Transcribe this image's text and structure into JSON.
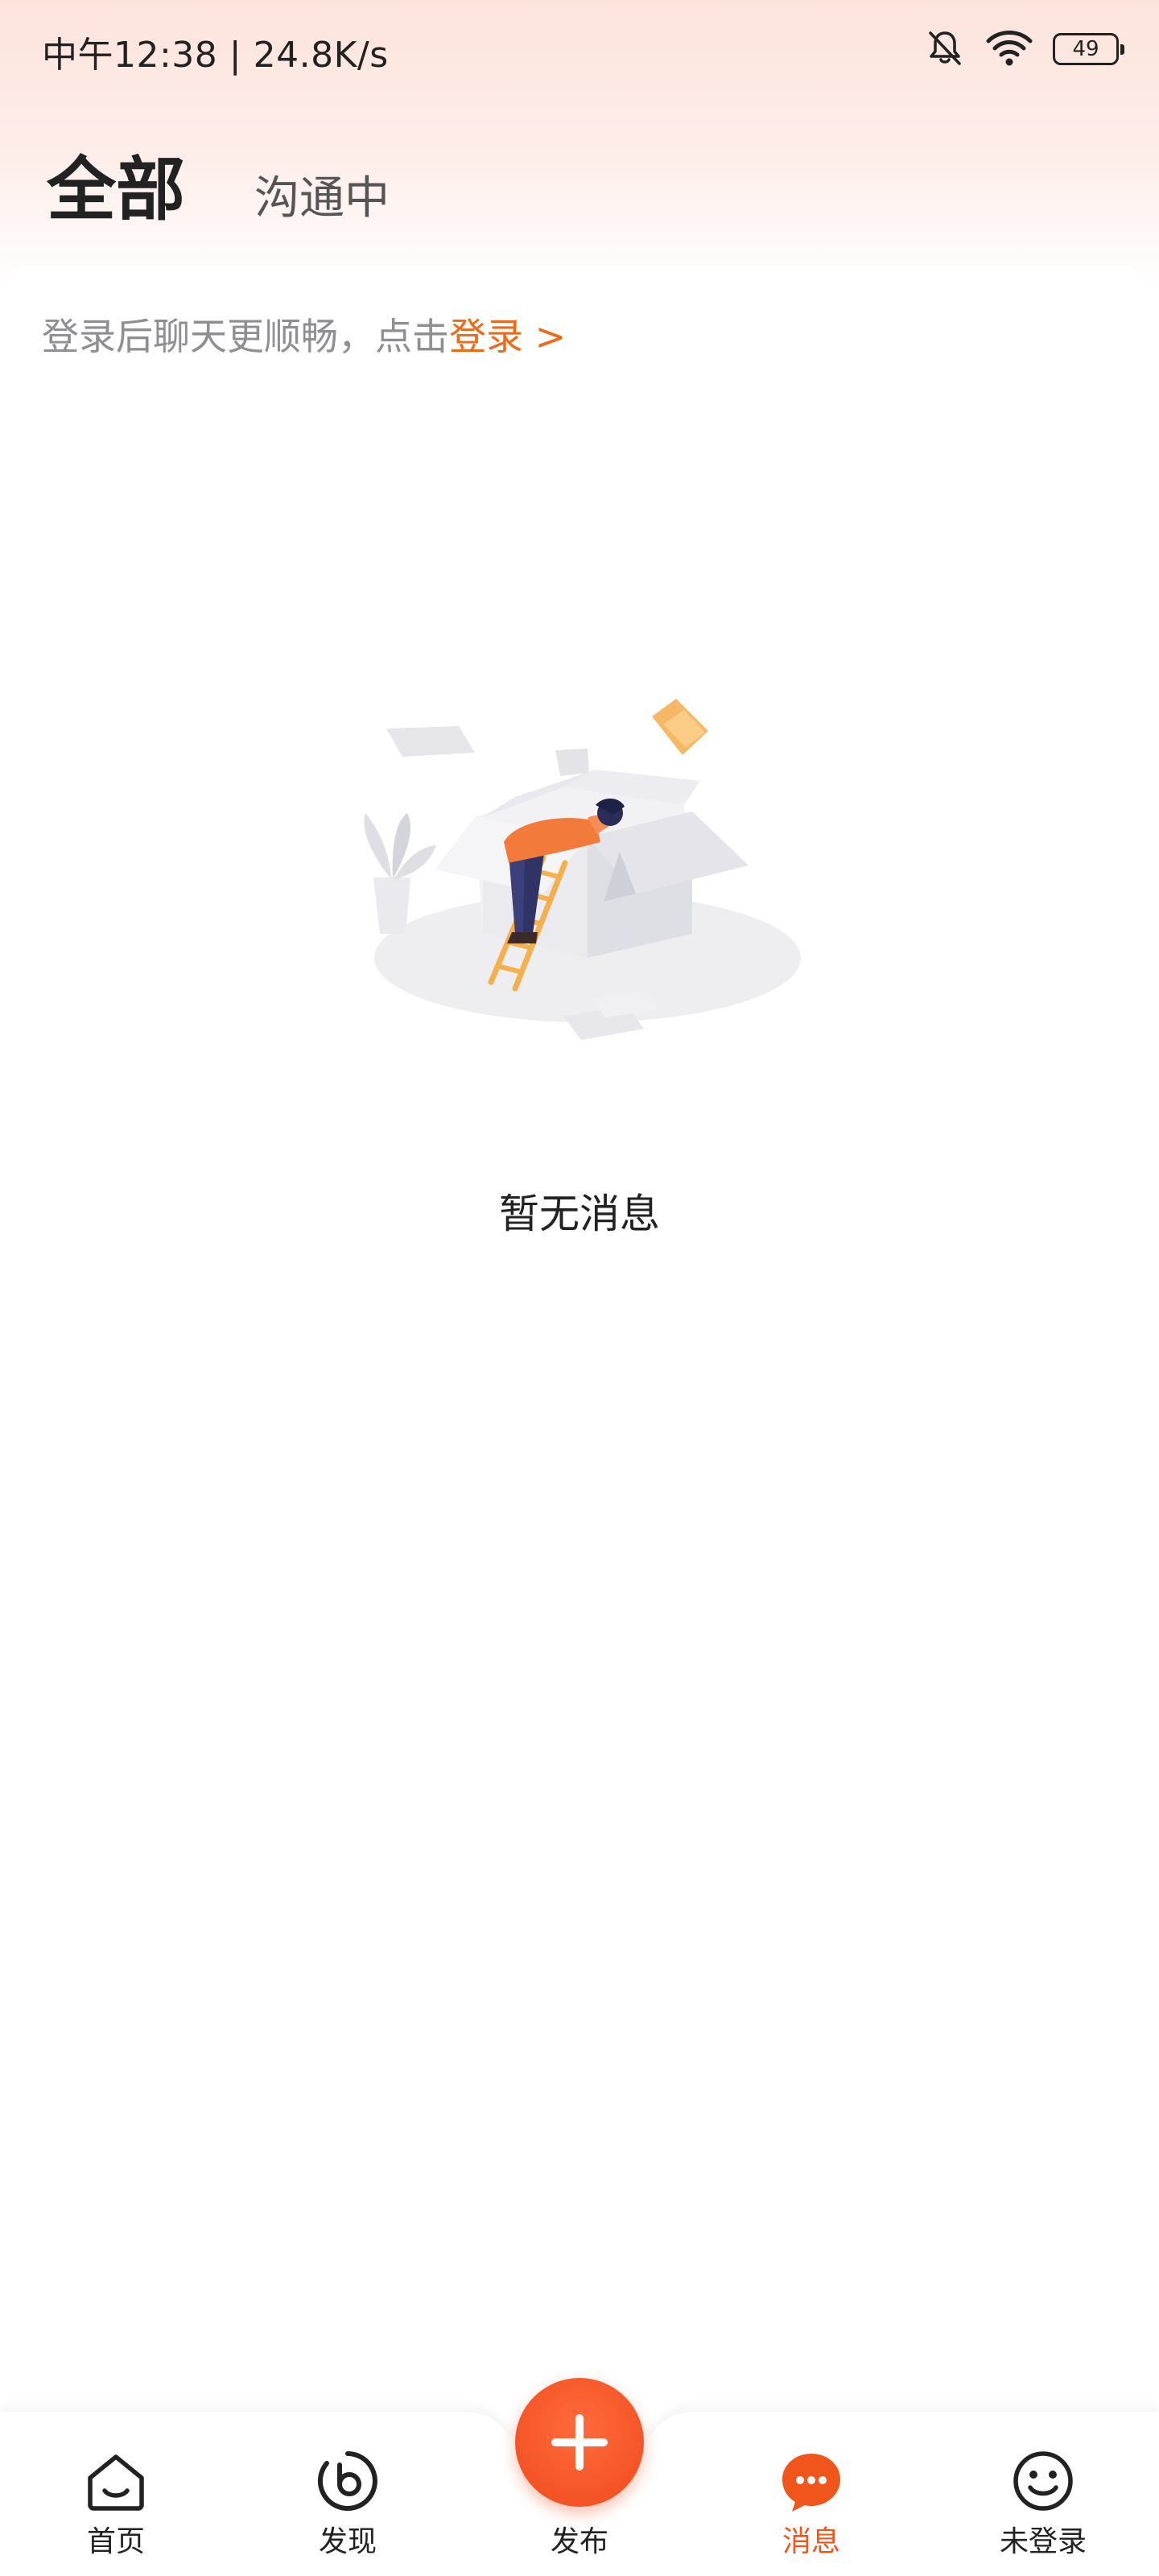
{
  "status_bar": {
    "time_and_speed": "中午12:38 | 24.8K/s",
    "battery_level": "49",
    "icons": [
      "bell-muted-icon",
      "wifi-icon",
      "battery-icon"
    ]
  },
  "tabs": [
    {
      "label": "全部",
      "active": true
    },
    {
      "label": "沟通中",
      "active": false
    }
  ],
  "login_tip": {
    "text": "登录后聊天更顺畅，点击",
    "link": "登录 >"
  },
  "empty_state": {
    "illustration": "empty-box-illustration",
    "text": "暂无消息"
  },
  "bottom_nav": {
    "items": [
      {
        "label": "首页",
        "icon": "home-icon",
        "active": false
      },
      {
        "label": "发现",
        "icon": "discover-icon",
        "active": false
      },
      {
        "label": "发布",
        "icon": "plus-icon",
        "active": false
      },
      {
        "label": "消息",
        "icon": "message-icon",
        "active": true
      },
      {
        "label": "未登录",
        "icon": "smiley-icon",
        "active": false
      }
    ]
  },
  "colors": {
    "accent": "#f06a16",
    "active_nav": "#f0561c",
    "publish_button": "#f04a1a",
    "header_gradient_top": "#fde3dc"
  }
}
